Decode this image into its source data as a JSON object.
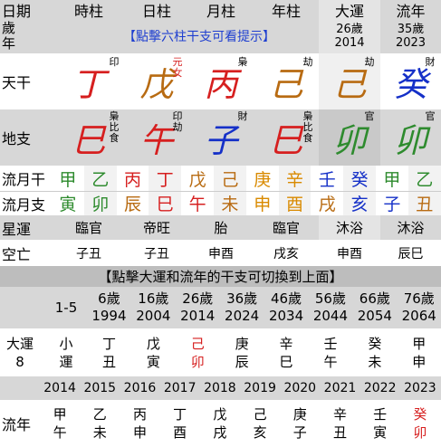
{
  "header": {
    "labels": [
      "日期",
      "時柱",
      "日柱",
      "月柱",
      "年柱",
      "大運",
      "流年"
    ]
  },
  "sui": {
    "label": "歲\n年",
    "hint": "【點擊六柱干支可看提示】",
    "dayun_age": "26歲",
    "dayun_year": "2014",
    "liunian_age": "35歲",
    "liunian_year": "2023"
  },
  "gan": {
    "label": "天干",
    "items": [
      {
        "char": "丁",
        "color": "#d61f1f",
        "tag": "印"
      },
      {
        "char": "戊",
        "color": "#b86b12",
        "tag": "元\n女",
        "tag_color": "#d61f1f"
      },
      {
        "char": "丙",
        "color": "#d61f1f",
        "tag": "梟"
      },
      {
        "char": "己",
        "color": "#b86b12",
        "tag": "劫"
      },
      {
        "char": "己",
        "color": "#b86b12",
        "tag": "劫"
      },
      {
        "char": "癸",
        "color": "#1530c8",
        "tag": "財"
      }
    ]
  },
  "zhi": {
    "label": "地支",
    "items": [
      {
        "char": "巳",
        "color": "#d61f1f",
        "tag": "梟\n比\n食"
      },
      {
        "char": "午",
        "color": "#d61f1f",
        "tag": "印\n劫"
      },
      {
        "char": "子",
        "color": "#1530c8",
        "tag": "財"
      },
      {
        "char": "巳",
        "color": "#d61f1f",
        "tag": "梟\n比\n食"
      },
      {
        "char": "卯",
        "color": "#2e8b2e",
        "tag": "官"
      },
      {
        "char": "卯",
        "color": "#2e8b2e",
        "tag": "官"
      }
    ]
  },
  "liuyue": {
    "label_gan": "流月干",
    "label_zhi": "流月支",
    "gan": [
      {
        "c": "甲",
        "col": "#2e8b2e"
      },
      {
        "c": "乙",
        "col": "#2e8b2e"
      },
      {
        "c": "丙",
        "col": "#d61f1f"
      },
      {
        "c": "丁",
        "col": "#d61f1f"
      },
      {
        "c": "戊",
        "col": "#b86b12"
      },
      {
        "c": "己",
        "col": "#b86b12"
      },
      {
        "c": "庚",
        "col": "#d98a00"
      },
      {
        "c": "辛",
        "col": "#d98a00"
      },
      {
        "c": "壬",
        "col": "#1530c8"
      },
      {
        "c": "癸",
        "col": "#1530c8"
      },
      {
        "c": "甲",
        "col": "#2e8b2e"
      },
      {
        "c": "乙",
        "col": "#2e8b2e"
      }
    ],
    "zhi": [
      {
        "c": "寅",
        "col": "#2e8b2e"
      },
      {
        "c": "卯",
        "col": "#2e8b2e"
      },
      {
        "c": "辰",
        "col": "#b86b12"
      },
      {
        "c": "巳",
        "col": "#d61f1f"
      },
      {
        "c": "午",
        "col": "#d61f1f"
      },
      {
        "c": "未",
        "col": "#b86b12"
      },
      {
        "c": "申",
        "col": "#d98a00"
      },
      {
        "c": "酉",
        "col": "#d98a00"
      },
      {
        "c": "戌",
        "col": "#b86b12"
      },
      {
        "c": "亥",
        "col": "#1530c8"
      },
      {
        "c": "子",
        "col": "#1530c8"
      },
      {
        "c": "丑",
        "col": "#b86b12"
      }
    ]
  },
  "xingyun": {
    "label": "星運",
    "items": [
      "臨官",
      "帝旺",
      "胎",
      "臨官",
      "沐浴",
      "沐浴"
    ]
  },
  "kongwang": {
    "label": "空亡",
    "items": [
      "子丑",
      "子丑",
      "申酉",
      "戌亥",
      "申酉",
      "辰巳"
    ]
  },
  "banner": "【點擊大運和流年的干支可切換到上面】",
  "dayun": {
    "first": "1-5",
    "ages": [
      {
        "age": "6歲",
        "year": "1994"
      },
      {
        "age": "16歲",
        "year": "2004"
      },
      {
        "age": "26歲",
        "year": "2014"
      },
      {
        "age": "36歲",
        "year": "2024"
      },
      {
        "age": "46歲",
        "year": "2034"
      },
      {
        "age": "56歲",
        "year": "2044"
      },
      {
        "age": "66歲",
        "year": "2054"
      },
      {
        "age": "76歲",
        "year": "2064"
      }
    ],
    "label": "大運",
    "label_num": "8",
    "first_gz": {
      "a": "小",
      "b": "運"
    },
    "gz": [
      {
        "a": "丁",
        "b": "丑",
        "red": false
      },
      {
        "a": "戊",
        "b": "寅",
        "red": false
      },
      {
        "a": "己",
        "b": "卯",
        "red": true
      },
      {
        "a": "庚",
        "b": "辰",
        "red": false
      },
      {
        "a": "辛",
        "b": "巳",
        "red": false
      },
      {
        "a": "壬",
        "b": "午",
        "red": false
      },
      {
        "a": "癸",
        "b": "未",
        "red": false
      },
      {
        "a": "甲",
        "b": "申",
        "red": false
      }
    ]
  },
  "liunian": {
    "label": "流年",
    "years": [
      "2014",
      "2015",
      "2016",
      "2017",
      "2018",
      "2019",
      "2020",
      "2021",
      "2022",
      "2023"
    ],
    "gz": [
      {
        "a": "甲",
        "b": "午",
        "red": false
      },
      {
        "a": "乙",
        "b": "未",
        "red": false
      },
      {
        "a": "丙",
        "b": "申",
        "red": false
      },
      {
        "a": "丁",
        "b": "酉",
        "red": false
      },
      {
        "a": "戊",
        "b": "戌",
        "red": false
      },
      {
        "a": "己",
        "b": "亥",
        "red": false
      },
      {
        "a": "庚",
        "b": "子",
        "red": false
      },
      {
        "a": "辛",
        "b": "丑",
        "red": false
      },
      {
        "a": "壬",
        "b": "寅",
        "red": false
      },
      {
        "a": "癸",
        "b": "卯",
        "red": true
      }
    ]
  },
  "colors": {
    "header_bg": "#d7d7d7",
    "dark_cell_bg": "#bdbdbd",
    "hint_text": "#1f3fd0",
    "highlight_red": "#d61f1f"
  }
}
